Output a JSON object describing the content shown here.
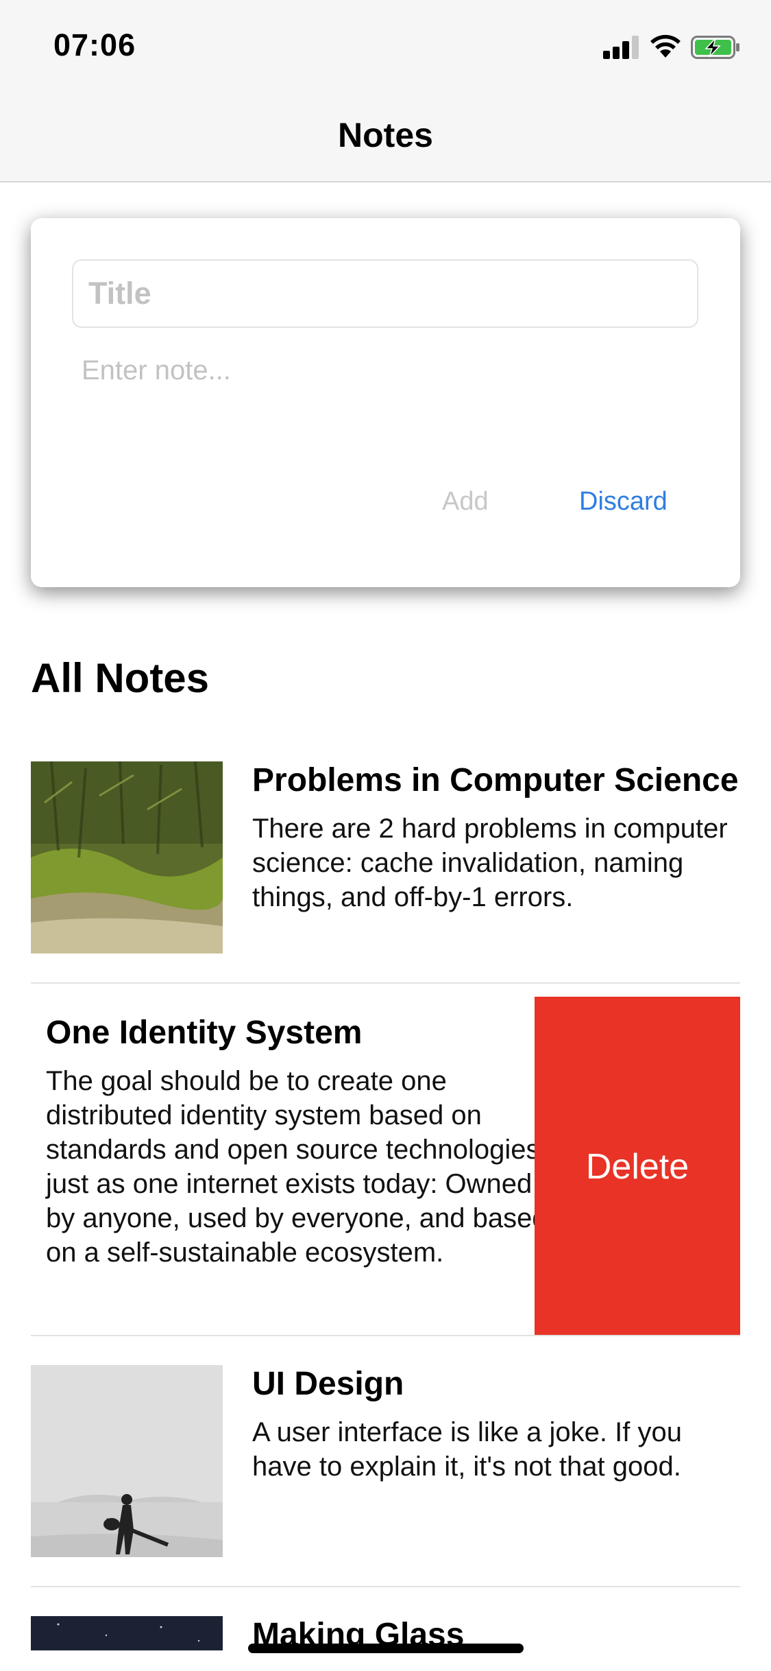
{
  "status_bar": {
    "time": "07:06",
    "icons": [
      "cellular-signal-icon",
      "wifi-icon",
      "battery-charging-icon"
    ]
  },
  "nav": {
    "title": "Notes"
  },
  "composer": {
    "title_placeholder": "Title",
    "note_placeholder": "Enter note...",
    "add_label": "Add",
    "discard_label": "Discard"
  },
  "section_title": "All Notes",
  "notes": [
    {
      "title": "Problems in Computer Science",
      "body": "There are 2 hard problems in computer science: cache invalidation, naming things, and off-by-1 errors.",
      "has_image": true,
      "image_desc": "mossy-landscape"
    },
    {
      "title": "One Identity System",
      "body": "The goal should be to create one distributed identity system based on standards and open source technologies just as one internet exists today: Owned by anyone, used by everyone, and based on a self-sustainable ecosystem.",
      "has_image": false,
      "swipe_action": "Delete"
    },
    {
      "title": "UI Design",
      "body": "A user interface is like a joke. If you have to explain it, it's not that good.",
      "has_image": true,
      "image_desc": "guitarist-in-desert"
    },
    {
      "title": "Making Glass",
      "body": "",
      "has_image": true,
      "image_desc": "night-sky"
    }
  ],
  "colors": {
    "accent": "#2f7ee0",
    "delete": "#e83326",
    "disabled": "#c7c7c7",
    "nav_bg": "#f6f6f6"
  }
}
